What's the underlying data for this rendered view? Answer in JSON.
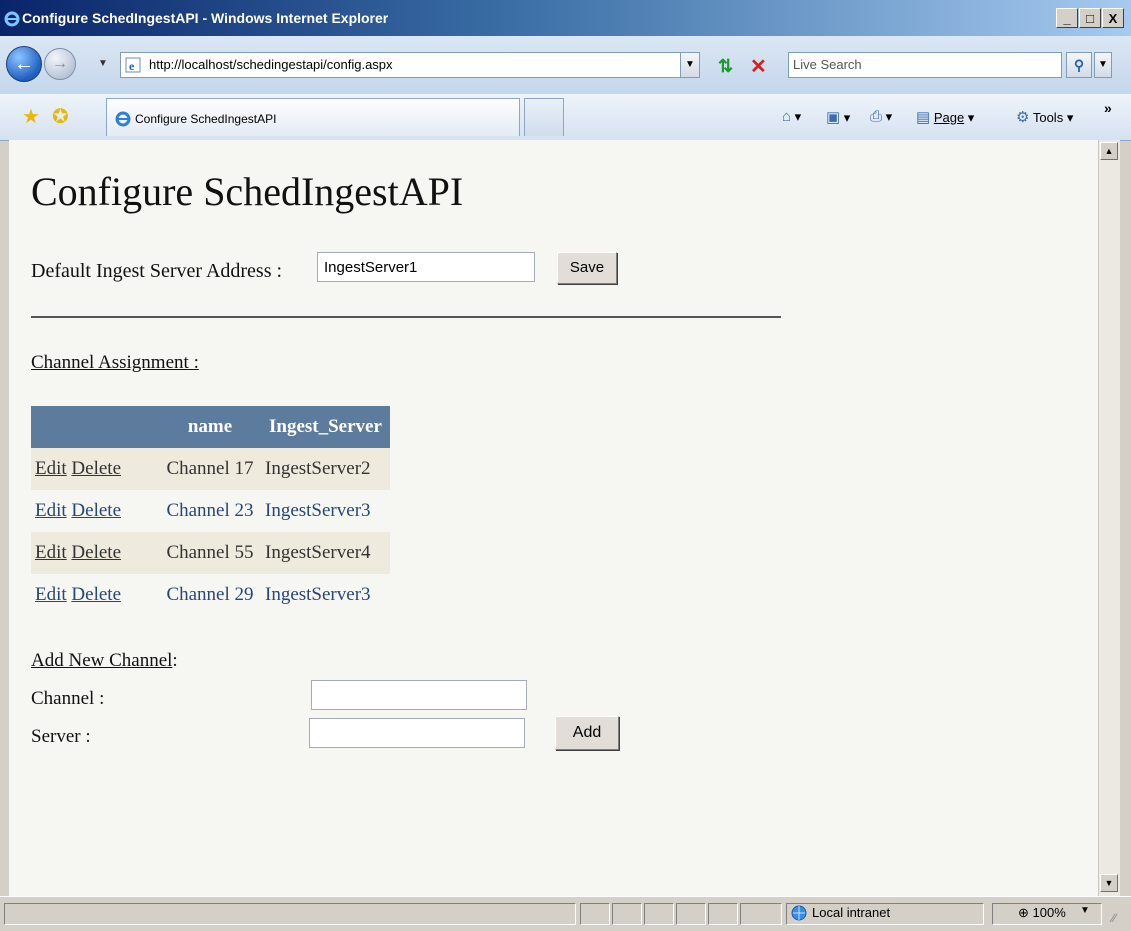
{
  "window": {
    "title": "Configure SchedIngestAPI - Windows Internet Explorer",
    "minimize": "_",
    "maximize": "□",
    "close": "X"
  },
  "address": {
    "url": "http://localhost/schedingestapi/config.aspx",
    "search_placeholder": "Live Search"
  },
  "toolbar": {
    "tab_title": "Configure SchedIngestAPI",
    "page_label": "Page",
    "tools_label": "Tools",
    "more": "»"
  },
  "page": {
    "title": "Configure SchedIngestAPI",
    "ingest_label": "Default Ingest Server Address :",
    "ingest_value": "IngestServer1",
    "save_label": "Save",
    "channel_assignment_label": "Channel Assignment",
    "channel_assignment_colon": ":",
    "grid": {
      "headers": [
        "",
        "name",
        "Ingest_Server"
      ],
      "edit_label": "Edit",
      "delete_label": "Delete",
      "rows": [
        {
          "name": "Channel 17",
          "server": "IngestServer2"
        },
        {
          "name": "Channel 23",
          "server": "IngestServer3"
        },
        {
          "name": "Channel 55",
          "server": "IngestServer4"
        },
        {
          "name": "Channel 29",
          "server": "IngestServer3"
        }
      ]
    },
    "add_new_label": "Add New Channel",
    "add_new_colon": ":",
    "channel_label": "Channel :",
    "server_label": "Server :",
    "add_label": "Add"
  },
  "status": {
    "zone": "Local intranet",
    "zoom": "100%"
  },
  "colors": {
    "grid_header": "#5d7b9d",
    "grid_link": "#284775"
  }
}
